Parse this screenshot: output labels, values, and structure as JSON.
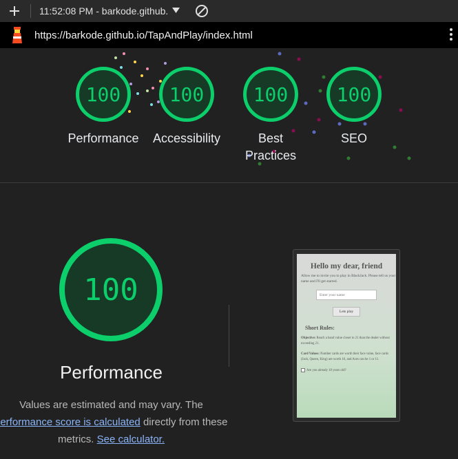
{
  "browser": {
    "time_title": "11:52:08 PM - barkode.github.",
    "url": "https://barkode.github.io/TapAndPlay/index.html"
  },
  "colors": {
    "pass": "#0cce6b",
    "background": "#212121",
    "link": "#8ab4f8"
  },
  "icons": [
    "plus-icon",
    "dropdown-caret-icon",
    "blocked-icon",
    "lighthouse-logo-icon",
    "kebab-menu-icon"
  ],
  "summary": {
    "gauges": [
      {
        "score": "100",
        "label": "Performance"
      },
      {
        "score": "100",
        "label": "Accessibility"
      },
      {
        "score": "100",
        "label": "Best Practices"
      },
      {
        "score": "100",
        "label": "SEO"
      }
    ]
  },
  "performance": {
    "score": "100",
    "title": "Performance",
    "desc_1": "Values are estimated and may vary. The",
    "link_1": "performance score is calculated",
    "desc_2": "directly from these",
    "desc_3": "metrics.",
    "link_2": "See calculator."
  },
  "screenshot": {
    "heading": "Hello my dear, friend",
    "intro": "Allow me to invite you to play in BlackJack. Please tell us your name and I'll get started.",
    "input_placeholder": "Enter your name",
    "button": "Lets play",
    "rules_title": "Short Rules:",
    "objective_label": "Objective:",
    "objective_text": "Reach a hand value closer to 21 than the dealer without exceeding 21.",
    "card_values_label": "Card Values:",
    "card_values_text": "Number cards are worth their face value, face cards (Jack, Queen, King) are worth 10, and Aces can be 1 or 11.",
    "age_question": "Are you already 18 years old?"
  }
}
